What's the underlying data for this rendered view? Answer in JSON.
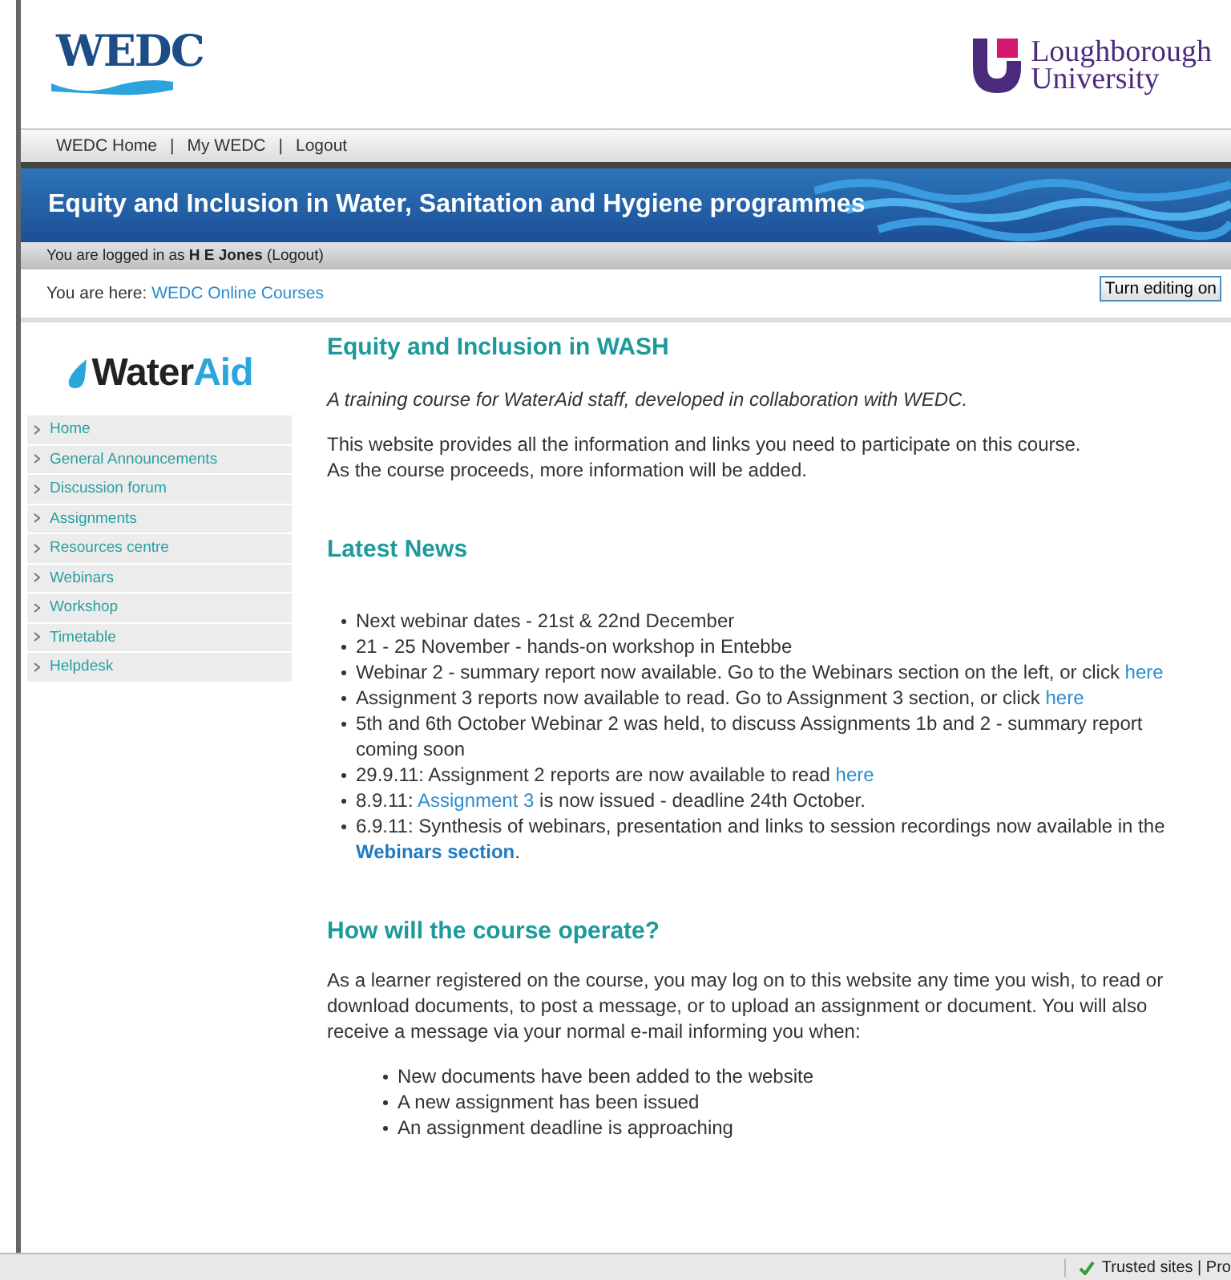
{
  "header": {
    "logo": "WEDC",
    "university_lines": [
      "Loughborough",
      "University"
    ]
  },
  "top_nav": {
    "separator": "|",
    "links": [
      {
        "label": "WEDC Home"
      },
      {
        "label": "My WEDC"
      },
      {
        "label": "Logout"
      }
    ]
  },
  "banner": {
    "title": "Equity and Inclusion in Water, Sanitation and Hygiene programmes"
  },
  "login_bar": {
    "text": "You are logged in as **H E Jones** (Logout)"
  },
  "breadcrumb": {
    "label": "You are here:",
    "link": "WEDC Online Courses"
  },
  "edit_button": {
    "label": "Turn editing on"
  },
  "sidebar": {
    "logo_first": "Water",
    "logo_second": "Aid",
    "items": [
      {
        "label": "Home"
      },
      {
        "label": "General Announcements"
      },
      {
        "label": "Discussion forum"
      },
      {
        "label": "Assignments"
      },
      {
        "label": "Resources centre"
      },
      {
        "label": "Webinars"
      },
      {
        "label": "Workshop"
      },
      {
        "label": "Timetable"
      },
      {
        "label": "Helpdesk"
      }
    ]
  },
  "content": {
    "title": "Equity and Inclusion in WASH",
    "tagline": "A training course for WaterAid staff, developed in collaboration with WEDC.",
    "intro": [
      "This website provides all the information and links you need to participate on this course.",
      "As the course proceeds, more information will be added."
    ],
    "news_heading": "Latest News",
    "news": [
      [
        {
          "kind": "text",
          "text": "Next webinar dates - 21st & 22nd December"
        }
      ],
      [
        {
          "kind": "text",
          "text": "21 - 25 November - hands-on workshop in Entebbe"
        }
      ],
      [
        {
          "kind": "text",
          "text": "Webinar 2 - summary report now available. Go to the Webinars section on the left, or click "
        },
        {
          "kind": "link",
          "text": "here"
        }
      ],
      [
        {
          "kind": "text",
          "text": "Assignment 3 reports now available to read. Go to Assignment 3 section, or click "
        },
        {
          "kind": "link",
          "text": "here"
        }
      ],
      [
        {
          "kind": "text",
          "text": "5th and 6th October Webinar 2 was held, to discuss Assignments 1b and 2 - summary report coming soon"
        }
      ],
      [
        {
          "kind": "text",
          "text": "29.9.11: Assignment 2 reports are now available to read "
        },
        {
          "kind": "link",
          "text": "here"
        }
      ],
      [
        {
          "kind": "text",
          "text": "8.9.11: "
        },
        {
          "kind": "link",
          "text": "Assignment 3"
        },
        {
          "kind": "text",
          "text": " is now issued - deadline 24th October."
        }
      ],
      [
        {
          "kind": "text",
          "text": "6.9.11: Synthesis of webinars, presentation and links to session recordings now available in the "
        },
        {
          "kind": "bold_link",
          "text": "Webinars section"
        },
        {
          "kind": "text",
          "text": "."
        }
      ]
    ],
    "operate_heading": "How will the course operate?",
    "operate_text": "As a learner registered on the course, you may log on to this website any time you wish, to read or download documents, to post a message, or to upload an assignment or document. You will also receive a message via your normal e-mail informing you when:",
    "operate_items": [
      "New documents have been added to the website",
      "A new assignment has been issued",
      "An assignment deadline is approaching"
    ]
  },
  "status_bar": {
    "zone": "Trusted sites | Pro"
  }
}
